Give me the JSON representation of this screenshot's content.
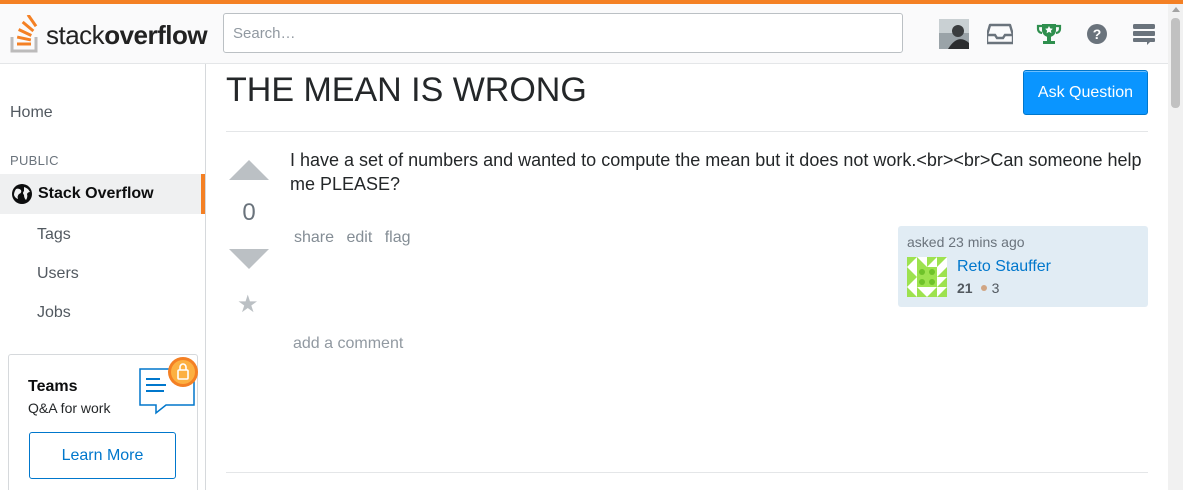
{
  "header": {
    "logo_text_light": "stack",
    "logo_text_bold": "overflow",
    "search_placeholder": "Search…",
    "brand_color": "#f48024"
  },
  "sidebar": {
    "home_label": "Home",
    "section_label": "PUBLIC",
    "active_item": "Stack Overflow",
    "items": [
      {
        "label": "Tags"
      },
      {
        "label": "Users"
      },
      {
        "label": "Jobs"
      }
    ],
    "teams": {
      "title": "Teams",
      "subtitle": "Q&A for work",
      "button_label": "Learn More"
    }
  },
  "question": {
    "title": "THE MEAN IS WRONG",
    "ask_button": "Ask Question",
    "vote_count": "0",
    "body": "I have a set of numbers and wanted to compute the mean but it does not work.<br><br>Can someone help me PLEASE?",
    "menu": [
      "share",
      "edit",
      "flag"
    ],
    "asked": "asked 23 mins ago",
    "user": {
      "name": "Reto Stauffer",
      "reputation": "21",
      "bronze_badges": "3"
    },
    "add_comment": "add a comment"
  },
  "colors": {
    "accent_blue": "#0a95ff",
    "link_blue": "#0077cc",
    "owner_card_bg": "#e1ecf4"
  }
}
